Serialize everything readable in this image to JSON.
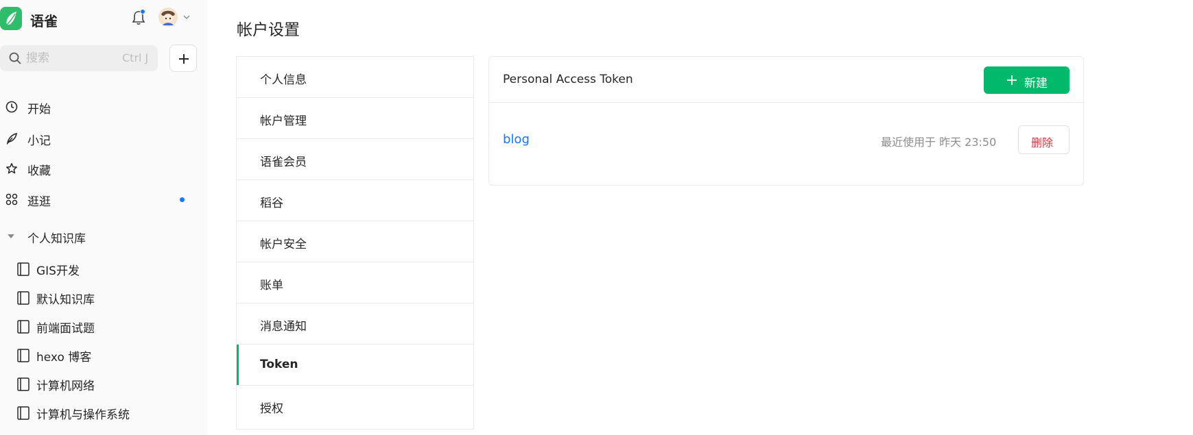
{
  "app": {
    "brand": "语雀"
  },
  "colors": {
    "accent": "#00b96b",
    "link": "#1677ff",
    "danger": "#d9363e",
    "notify_dot": "#1677ff"
  },
  "sidebar": {
    "search": {
      "placeholder": "搜索",
      "shortcut": "Ctrl J"
    },
    "nav": [
      {
        "label": "开始",
        "icon": "clock-icon"
      },
      {
        "label": "小记",
        "icon": "feather-icon"
      },
      {
        "label": "收藏",
        "icon": "star-icon"
      },
      {
        "label": "逛逛",
        "icon": "grid-icon",
        "has_dot": true
      }
    ],
    "knowledge_base": {
      "title": "个人知识库",
      "books": [
        {
          "label": "GIS开发"
        },
        {
          "label": "默认知识库"
        },
        {
          "label": "前端面试题"
        },
        {
          "label": "hexo 博客"
        },
        {
          "label": "计算机网络"
        },
        {
          "label": "计算机与操作系统"
        }
      ]
    }
  },
  "main": {
    "page_title": "帐户设置",
    "menu": [
      {
        "label": "个人信息"
      },
      {
        "label": "帐户管理"
      },
      {
        "label": "语雀会员"
      },
      {
        "label": "稻谷"
      },
      {
        "label": "帐户安全"
      },
      {
        "label": "账单"
      },
      {
        "label": "消息通知"
      },
      {
        "label": "Token",
        "active": true
      },
      {
        "label": "授权"
      }
    ],
    "token_card": {
      "title": "Personal Access Token",
      "new_button": "新建",
      "tokens": [
        {
          "name": "blog",
          "last_used": "最近使用于 昨天 23:50",
          "delete_label": "删除"
        }
      ]
    }
  }
}
